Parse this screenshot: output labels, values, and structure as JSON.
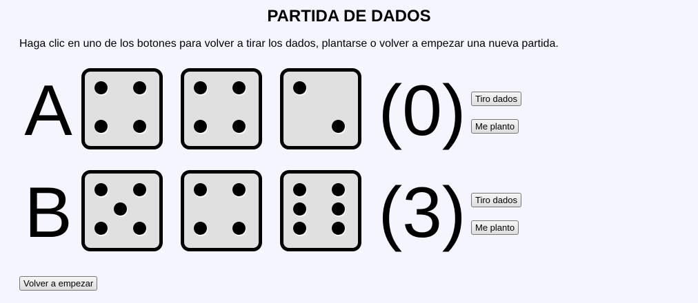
{
  "page": {
    "title": "PARTIDA DE DADOS",
    "instructions": "Haga clic en uno de los botones para volver a tirar los dados, plantarse o volver a empezar una nueva partida."
  },
  "players": [
    {
      "label": "A",
      "dice": [
        4,
        4,
        2
      ],
      "score": "(0)",
      "roll_label": "Tiro dados",
      "stand_label": "Me planto"
    },
    {
      "label": "B",
      "dice": [
        5,
        4,
        6
      ],
      "score": "(3)",
      "roll_label": "Tiro dados",
      "stand_label": "Me planto"
    }
  ],
  "restart_label": "Volver a empezar",
  "colors": {
    "background": "#f5f5ff",
    "die_face": "#e0e0e0",
    "pip": "#000000"
  }
}
